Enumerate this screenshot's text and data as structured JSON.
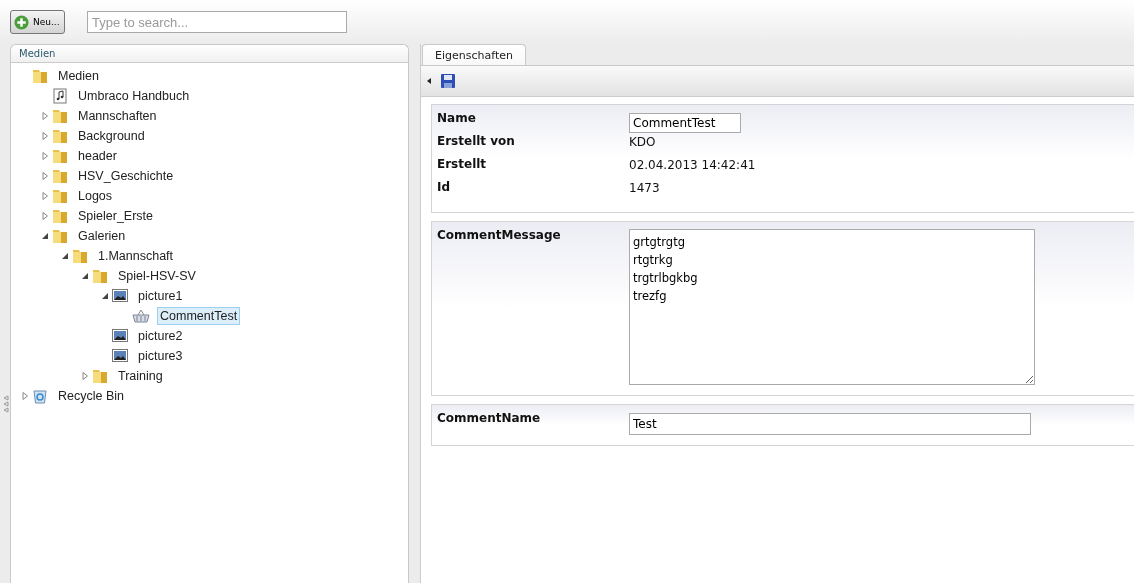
{
  "toolbar": {
    "new_button": "Neu...",
    "search": {
      "placeholder": "Type to search..."
    }
  },
  "tree_panel": {
    "title": "Medien",
    "items": [
      {
        "label": "Medien",
        "kind": "folder",
        "selected": false,
        "children": [
          {
            "label": "Umbraco Handbuch",
            "kind": "audio",
            "selected": false
          },
          {
            "label": "Mannschaften",
            "kind": "folder",
            "selected": false,
            "expanded": false
          },
          {
            "label": "Background",
            "kind": "folder",
            "selected": false,
            "expanded": false
          },
          {
            "label": "header",
            "kind": "folder",
            "selected": false,
            "expanded": false
          },
          {
            "label": "HSV_Geschichte",
            "kind": "folder",
            "selected": false,
            "expanded": false
          },
          {
            "label": "Logos",
            "kind": "folder",
            "selected": false,
            "expanded": false
          },
          {
            "label": "Spieler_Erste",
            "kind": "folder",
            "selected": false,
            "expanded": false
          },
          {
            "label": "Galerien",
            "kind": "folder",
            "selected": false,
            "expanded": true,
            "children": [
              {
                "label": "1.Mannschaft",
                "kind": "folder",
                "selected": false,
                "expanded": true,
                "children": [
                  {
                    "label": "Spiel-HSV-SV",
                    "kind": "folder",
                    "selected": false,
                    "expanded": true,
                    "children": [
                      {
                        "label": "picture1",
                        "kind": "picture",
                        "selected": false,
                        "expanded": true,
                        "children": [
                          {
                            "label": "CommentTest",
                            "kind": "comment",
                            "selected": true
                          }
                        ]
                      },
                      {
                        "label": "picture2",
                        "kind": "picture",
                        "selected": false
                      },
                      {
                        "label": "picture3",
                        "kind": "picture",
                        "selected": false
                      }
                    ]
                  },
                  {
                    "label": "Training",
                    "kind": "folder",
                    "selected": false,
                    "expanded": false
                  }
                ]
              }
            ]
          }
        ]
      },
      {
        "label": "Recycle Bin",
        "kind": "recycle",
        "selected": false,
        "expanded": false
      }
    ]
  },
  "editor": {
    "tabs": [
      {
        "label": "Eigenschaften",
        "selected": true
      }
    ],
    "sections": [
      {
        "rows": [
          {
            "label": "Name",
            "kind": "input",
            "value": "CommentTest"
          },
          {
            "label": "Erstellt von",
            "kind": "text",
            "value": "KDO"
          },
          {
            "label": "Erstellt",
            "kind": "text",
            "value": "02.04.2013 14:42:41"
          },
          {
            "label": "Id",
            "kind": "text",
            "value": "1473"
          }
        ]
      },
      {
        "rows": [
          {
            "label": "CommentMessage",
            "kind": "textarea",
            "value": "grtgtrgtg\nrtgtrkg\ntrgtrlbgkbg\ntrezfg"
          }
        ]
      },
      {
        "rows": [
          {
            "label": "CommentName",
            "kind": "wide-input",
            "value": "Test"
          }
        ]
      }
    ]
  }
}
